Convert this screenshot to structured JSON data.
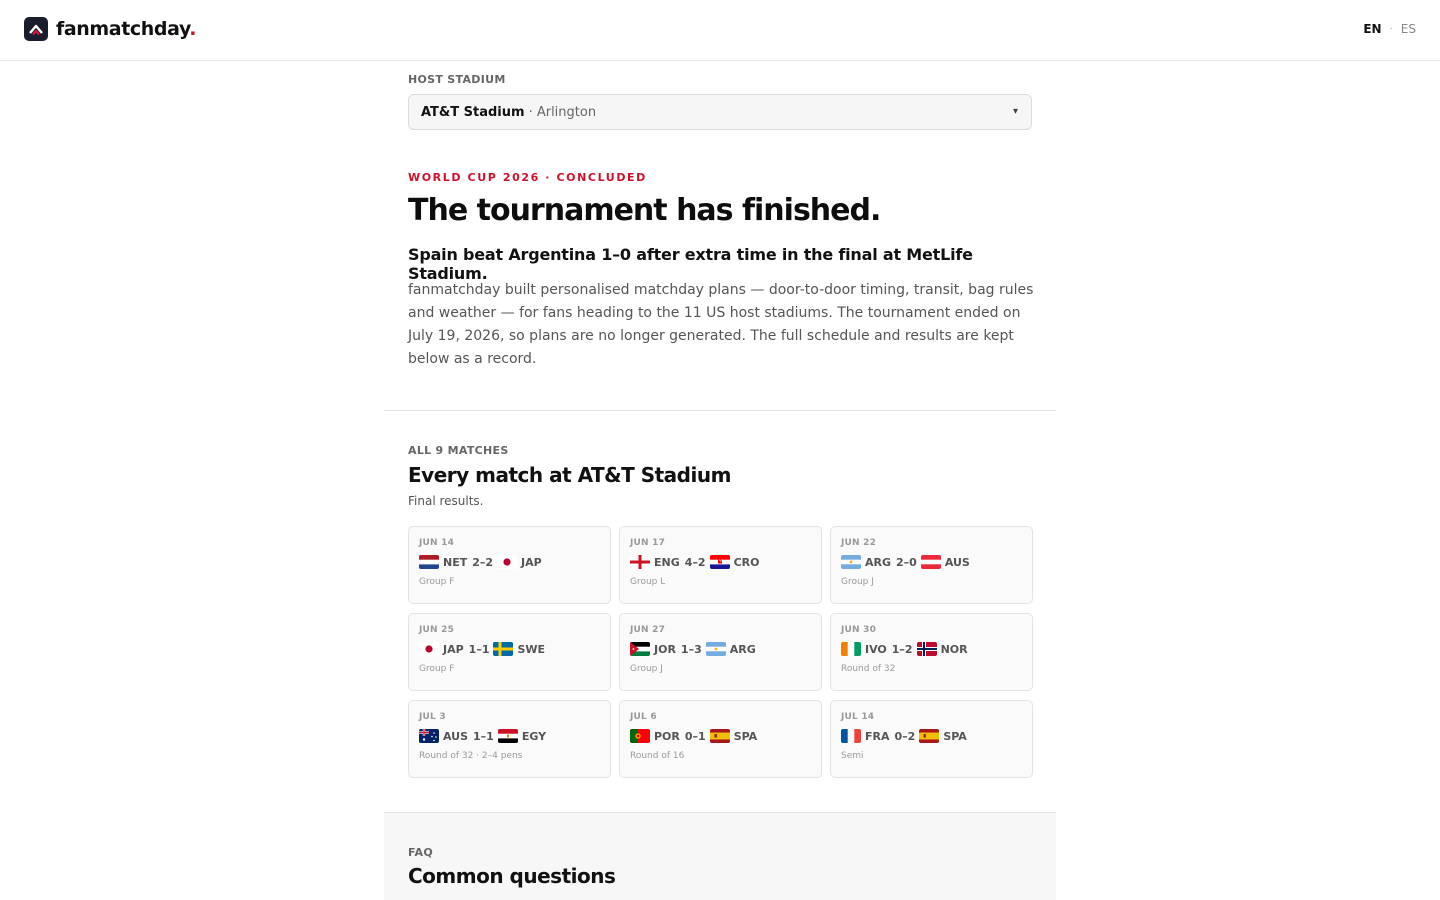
{
  "header": {
    "brand_name": "fanmatchday",
    "brand_dot": ".",
    "lang_en": "EN",
    "lang_sep": "·",
    "lang_es": "ES"
  },
  "stadium_picker": {
    "label": "HOST STADIUM",
    "selected_name": "AT&T Stadium",
    "selected_city": "· Arlington",
    "caret": "▾"
  },
  "hero": {
    "kicker": "WORLD CUP 2026 · CONCLUDED",
    "headline": "The tournament has finished.",
    "subhead": "Spain beat Argentina 1–0 after extra time in the final at MetLife Stadium.",
    "blurb": "fanmatchday built personalised matchday plans — door-to-door timing, transit, bag rules and weather — for fans heading to the 11 US host stadiums. The tournament ended on July 19, 2026, so plans are no longer generated. The full schedule and results are kept below as a record."
  },
  "matches": {
    "label": "ALL 9 MATCHES",
    "title": "Every match at AT&T Stadium",
    "subtitle": "Final results.",
    "items": [
      {
        "date": "JUN 14",
        "home": "NET",
        "score": "2–2",
        "away": "JAP",
        "stage": "Group F",
        "home_flag": "netherlands-flag-icon",
        "away_flag": "japan-flag-icon"
      },
      {
        "date": "JUN 17",
        "home": "ENG",
        "score": "4–2",
        "away": "CRO",
        "stage": "Group L",
        "home_flag": "england-flag-icon",
        "away_flag": "croatia-flag-icon"
      },
      {
        "date": "JUN 22",
        "home": "ARG",
        "score": "2–0",
        "away": "AUS",
        "stage": "Group J",
        "home_flag": "argentina-flag-icon",
        "away_flag": "austria-flag-icon"
      },
      {
        "date": "JUN 25",
        "home": "JAP",
        "score": "1–1",
        "away": "SWE",
        "stage": "Group F",
        "home_flag": "japan-flag-icon",
        "away_flag": "sweden-flag-icon"
      },
      {
        "date": "JUN 27",
        "home": "JOR",
        "score": "1–3",
        "away": "ARG",
        "stage": "Group J",
        "home_flag": "jordan-flag-icon",
        "away_flag": "argentina-flag-icon"
      },
      {
        "date": "JUN 30",
        "home": "IVO",
        "score": "1–2",
        "away": "NOR",
        "stage": "Round of 32",
        "home_flag": "ivory-coast-flag-icon",
        "away_flag": "norway-flag-icon"
      },
      {
        "date": "JUL 3",
        "home": "AUS",
        "score": "1–1",
        "away": "EGY",
        "stage": "Round of 32 · 2–4 pens",
        "home_flag": "australia-flag-icon",
        "away_flag": "egypt-flag-icon"
      },
      {
        "date": "JUL 6",
        "home": "POR",
        "score": "0–1",
        "away": "SPA",
        "stage": "Round of 16",
        "home_flag": "portugal-flag-icon",
        "away_flag": "spain-flag-icon"
      },
      {
        "date": "JUL 14",
        "home": "FRA",
        "score": "0–2",
        "away": "SPA",
        "stage": "Semi",
        "home_flag": "france-flag-icon",
        "away_flag": "spain-flag-icon"
      }
    ]
  },
  "faq": {
    "label": "FAQ",
    "title": "Common questions"
  },
  "colors": {
    "accent_red": "#d0102b",
    "logo_bg": "#1a1d2e"
  }
}
